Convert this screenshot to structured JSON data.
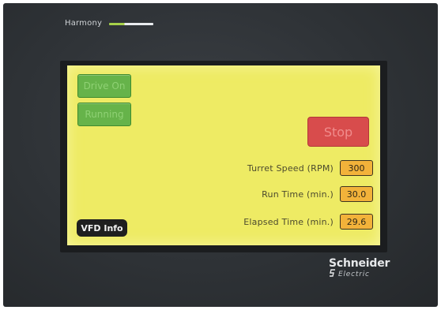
{
  "panel": {
    "brand_top": "Harmony",
    "brand_bottom": "Schneider",
    "brand_bottom_sub": "Electric"
  },
  "screen": {
    "buttons": {
      "top_left_1": "Drive On",
      "top_left_2": "Running",
      "stop": "Stop",
      "vfd_info": "VFD Info"
    },
    "fields": [
      {
        "label": "Turret Speed (RPM)",
        "value": "300"
      },
      {
        "label": "Run Time (min.)",
        "value": "30.0"
      },
      {
        "label": "Elapsed Time (min.)",
        "value": "29.6"
      }
    ]
  },
  "colors": {
    "screen_bg": "#eeeb64",
    "green_button": "#66b34a",
    "stop_button": "#d84c4c",
    "value_box": "#f2b23a",
    "bezel": "#2e3236"
  }
}
